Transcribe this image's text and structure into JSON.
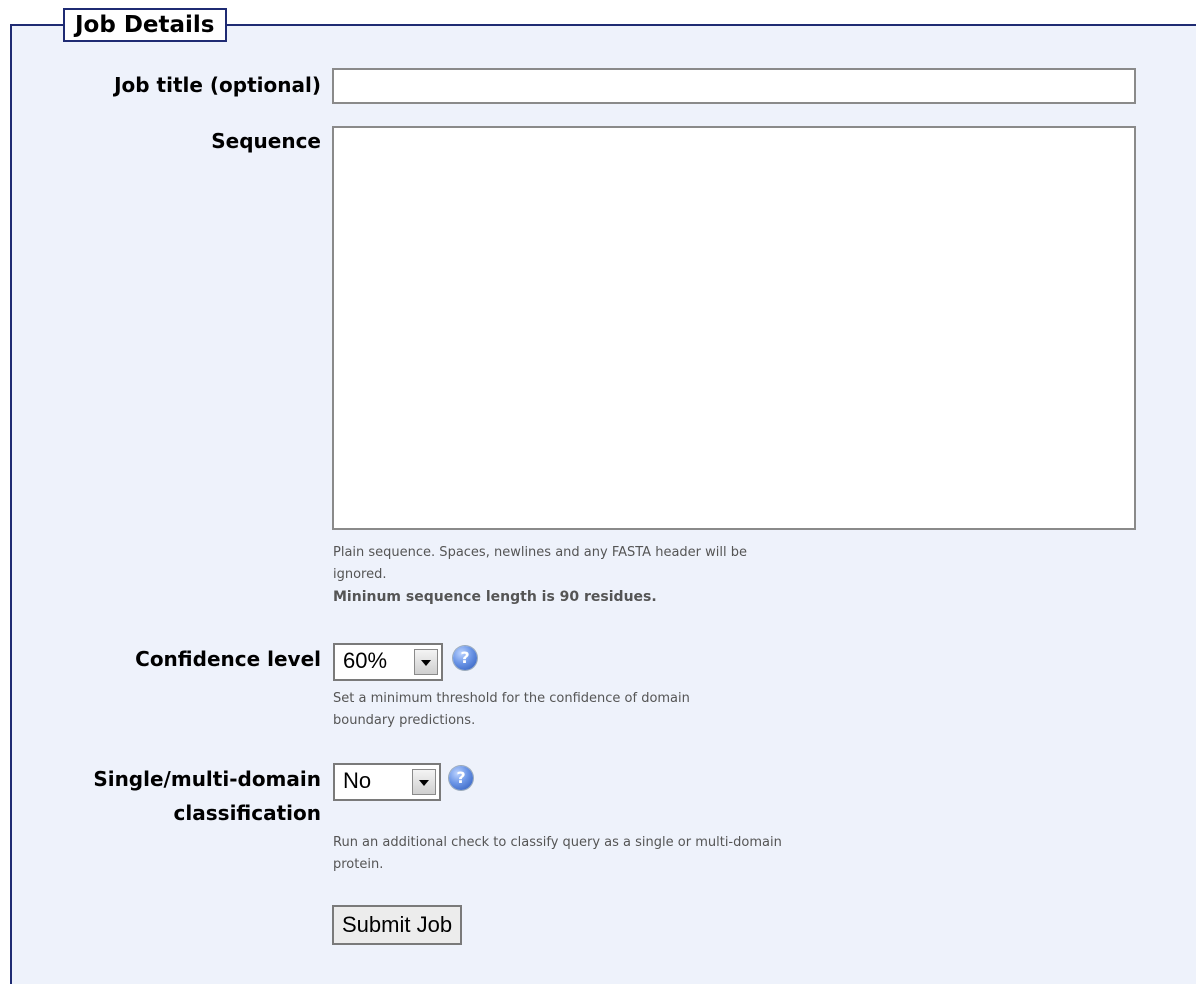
{
  "legend": "Job Details",
  "fields": {
    "job_title": {
      "label": "Job title (optional)",
      "value": ""
    },
    "sequence": {
      "label": "Sequence",
      "value": "",
      "help": "Plain sequence. Spaces, newlines and any FASTA header will be ignored.",
      "note": "Mininum sequence length is 90 residues."
    },
    "confidence": {
      "label": "Confidence level",
      "selected": "60%",
      "help": "Set a minimum threshold for the confidence of domain boundary predictions."
    },
    "classification": {
      "label_line1": "Single/multi-domain",
      "label_line2": "classification",
      "selected": "No",
      "help": "Run an additional check to classify query as a single or multi-domain protein."
    }
  },
  "submit_label": "Submit Job",
  "icons": {
    "help": "help-question-icon"
  },
  "colors": {
    "panel_bg": "#eef2fb",
    "border": "#1f2b73"
  }
}
